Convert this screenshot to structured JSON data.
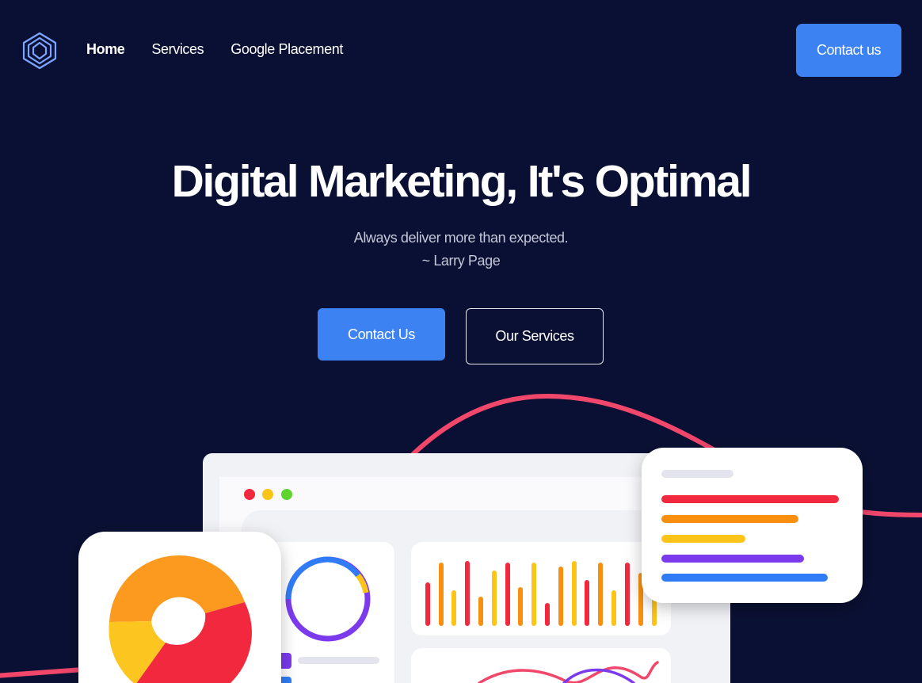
{
  "header": {
    "logo_icon": "layered-diamond-logo-icon",
    "nav": [
      {
        "label": "Home",
        "active": true
      },
      {
        "label": "Services",
        "active": false
      },
      {
        "label": "Google Placement",
        "active": false
      }
    ],
    "cta_label": "Contact us"
  },
  "hero": {
    "title": "Digital Marketing, It's Optimal",
    "quote": "Always deliver more than expected.",
    "quote_author": "~ Larry Page",
    "primary_button": "Contact Us",
    "secondary_button": "Our Services"
  },
  "colors": {
    "background": "#0a1033",
    "accent": "#3d82f2",
    "curve": "#f0476b"
  }
}
